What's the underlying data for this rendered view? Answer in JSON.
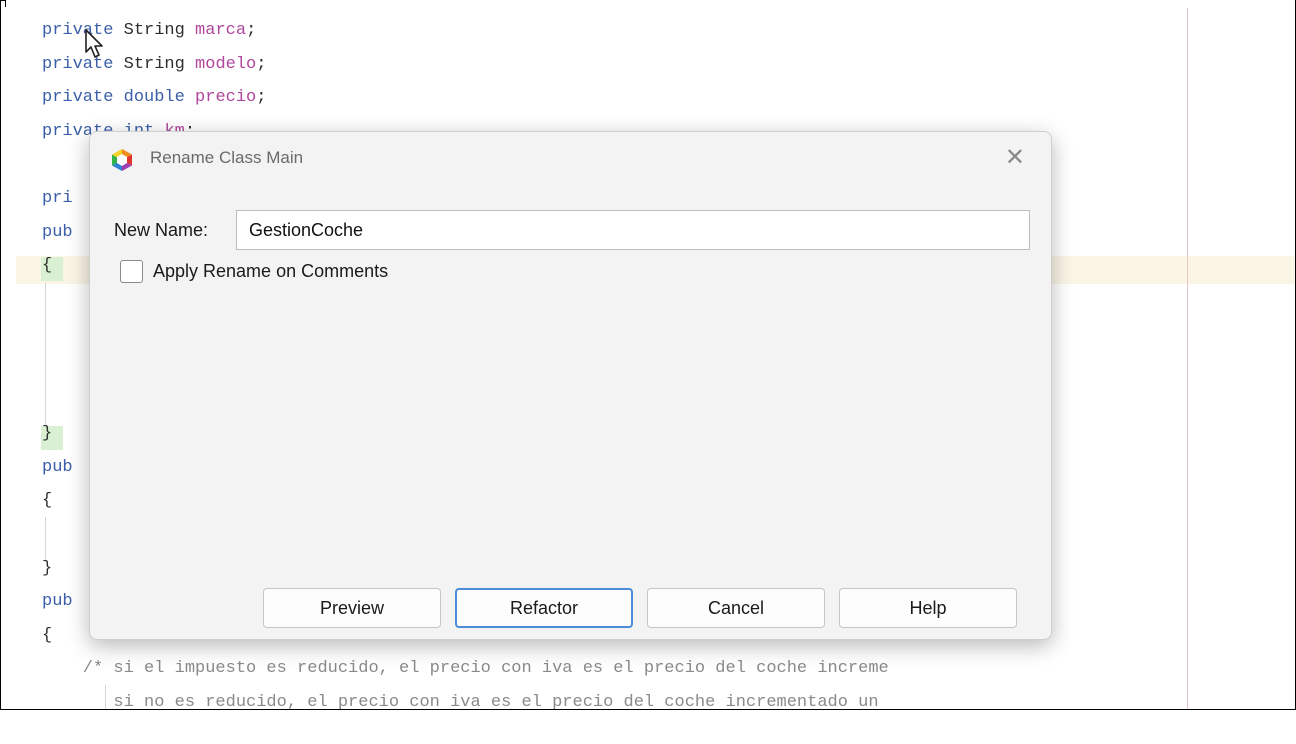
{
  "editor": {
    "lines": [
      [
        {
          "t": "private",
          "c": "kw"
        },
        {
          "t": " String ",
          "c": ""
        },
        {
          "t": "marca",
          "c": "fld"
        },
        {
          "t": ";",
          "c": ""
        }
      ],
      [
        {
          "t": "private",
          "c": "kw"
        },
        {
          "t": " String ",
          "c": ""
        },
        {
          "t": "modelo",
          "c": "fld"
        },
        {
          "t": ";",
          "c": ""
        }
      ],
      [
        {
          "t": "private",
          "c": "kw"
        },
        {
          "t": " double ",
          "c": "kw"
        },
        {
          "t": "precio",
          "c": "fld"
        },
        {
          "t": ";",
          "c": ""
        }
      ],
      [
        {
          "t": "private",
          "c": "kw"
        },
        {
          "t": " int ",
          "c": "kw"
        },
        {
          "t": "km",
          "c": "fld"
        },
        {
          "t": ";",
          "c": ""
        }
      ],
      [],
      [
        {
          "t": "pri",
          "c": "kw"
        }
      ],
      [
        {
          "t": "pub",
          "c": "kw"
        }
      ],
      [
        {
          "t": "{",
          "c": ""
        }
      ],
      [],
      [],
      [],
      [],
      [
        {
          "t": "}",
          "c": ""
        }
      ],
      [
        {
          "t": "pub",
          "c": "kw"
        }
      ],
      [
        {
          "t": "{",
          "c": ""
        }
      ],
      [],
      [
        {
          "t": "}",
          "c": ""
        }
      ],
      [
        {
          "t": "pub",
          "c": "kw"
        }
      ],
      [
        {
          "t": "{",
          "c": ""
        }
      ],
      [
        {
          "t": "    /* si el impuesto es reducido, el precio con iva es el precio del coche increme",
          "c": "cm"
        }
      ],
      [
        {
          "t": "       si no es reducido, el precio con iva es el precio del coche incrementado un",
          "c": "cm"
        }
      ]
    ]
  },
  "dialog": {
    "title": "Rename Class Main",
    "close_glyph": "✕",
    "new_name_label": "New Name:",
    "new_name_value": "GestionCoche",
    "apply_comments_label": "Apply Rename on Comments",
    "apply_comments_checked": false,
    "buttons": {
      "preview": "Preview",
      "refactor": "Refactor",
      "cancel": "Cancel",
      "help": "Help"
    }
  },
  "icons": {
    "app_logo": "netbeans-logo-icon",
    "cursor": "mouse-pointer-icon"
  },
  "colors": {
    "keyword": "#3a5fa8",
    "field": "#b0479c",
    "primary_button_border": "#4a8fd6"
  }
}
